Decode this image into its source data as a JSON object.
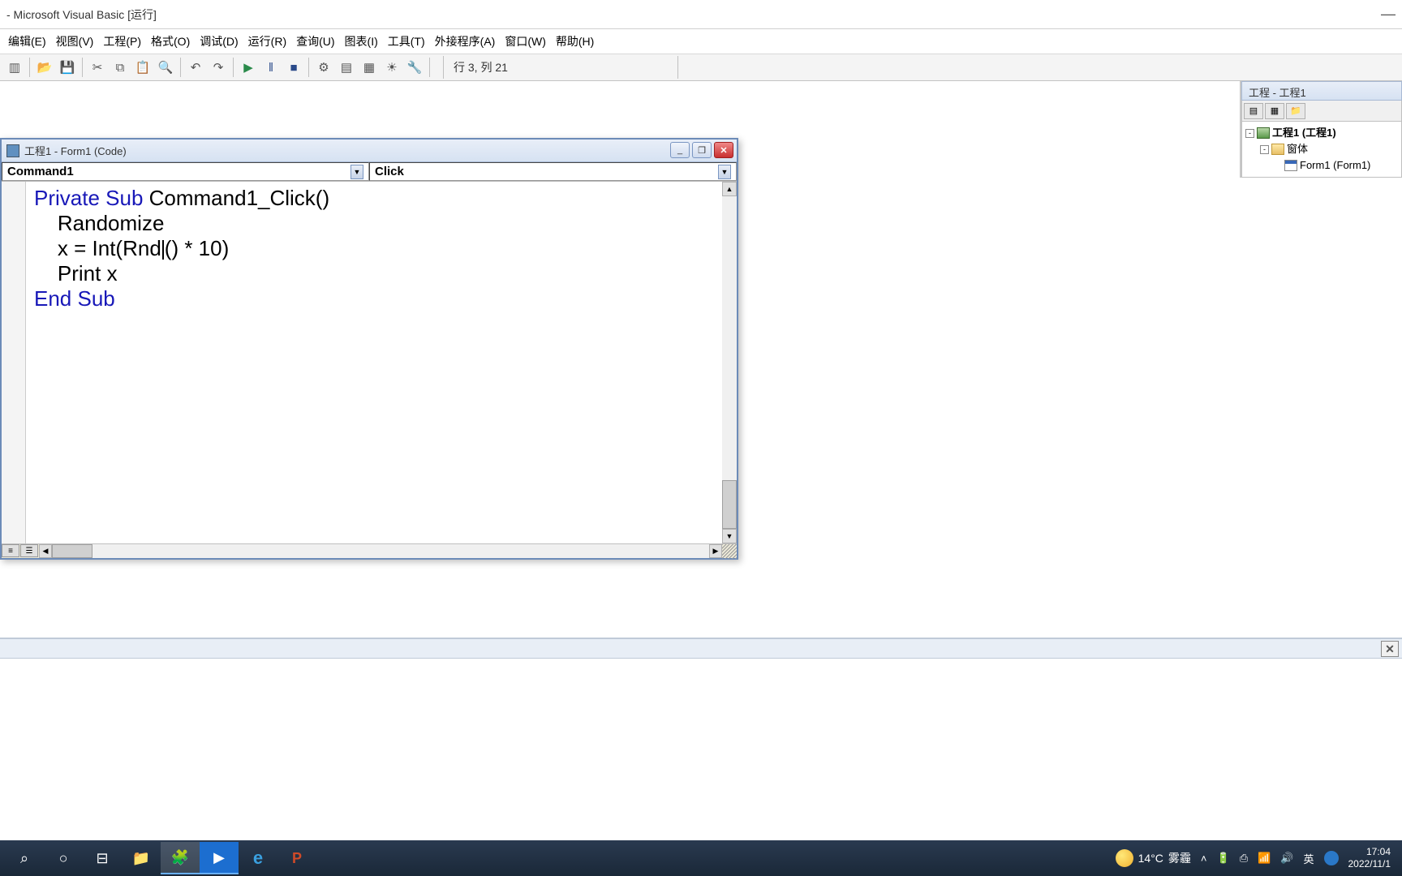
{
  "titlebar": {
    "text": " - Microsoft Visual Basic [运行]"
  },
  "menu": {
    "edit": "编辑(E)",
    "view": "视图(V)",
    "project": "工程(P)",
    "format": "格式(O)",
    "debug": "调试(D)",
    "run": "运行(R)",
    "query": "查询(U)",
    "diagram": "图表(I)",
    "tools": "工具(T)",
    "addins": "外接程序(A)",
    "window": "窗口(W)",
    "help": "帮助(H)"
  },
  "status": {
    "cursor": "行 3, 列 21"
  },
  "codewin": {
    "title": "工程1 - Form1 (Code)",
    "object_combo": "Command1",
    "proc_combo": "Click",
    "code_line1_kw1": "Private Sub",
    "code_line1_rest": " Command1_Click()",
    "code_line2": "    Randomize",
    "code_line3a": "    x = Int(Rnd",
    "code_line3b": "() * 10)",
    "code_line4": "    Print x",
    "code_line5_kw": "End Sub"
  },
  "project_panel": {
    "title": "工程 - 工程1",
    "root": "工程1 (工程1)",
    "folder": "窗体",
    "form": "Form1 (Form1)"
  },
  "taskbar": {
    "weather_temp": "14°C",
    "weather_cond": "雾霾",
    "ime": "英",
    "time": "17:04",
    "date": "2022/11/1"
  },
  "icons": {
    "search": "⌕",
    "cortana": "○",
    "tasks": "⊟",
    "folder": "📁",
    "vb": "🧩",
    "video": "▶",
    "edge": "e",
    "ppt": "P"
  }
}
